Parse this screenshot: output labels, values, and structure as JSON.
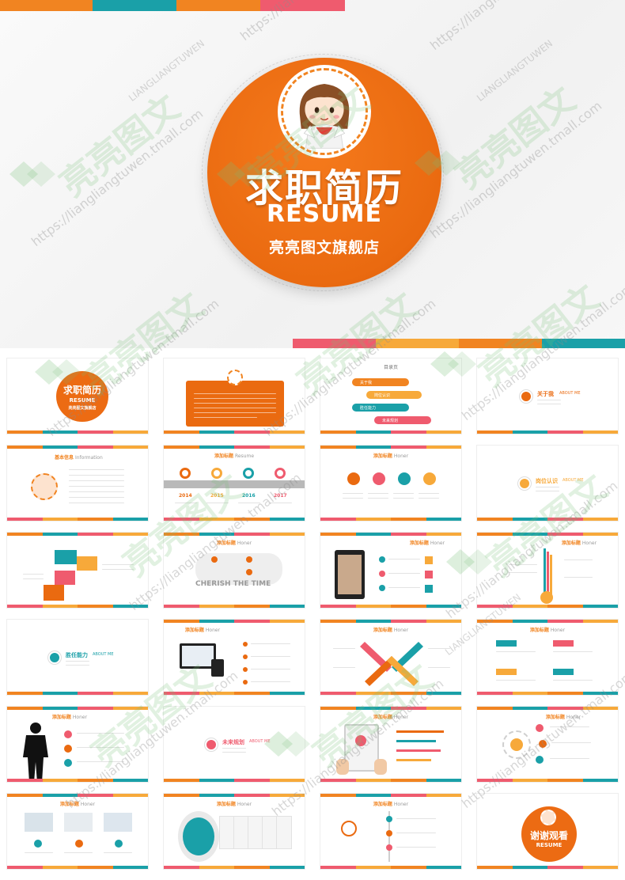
{
  "colors": {
    "orange": "#f18421",
    "teal": "#1aa0a8",
    "pink": "#ef5b6e",
    "yellow": "#f7a93a",
    "hero_circle": "#ea6a10"
  },
  "hero": {
    "title": "求职简历",
    "subtitle": "RESUME",
    "shop": "亮亮图文旗舰店"
  },
  "watermark": {
    "url": "https://liangliangtuwen.tmall.com",
    "brand": "亮亮图文",
    "pinyin": "LIANGLIANGTUWEN"
  },
  "thumbnails": {
    "cover": {
      "title": "求职简历",
      "subtitle": "RESUME",
      "shop": "亮亮图文旗舰店"
    },
    "toc": {
      "header": "目录页",
      "items": [
        {
          "label": "关于我",
          "en": "ABOUT ME"
        },
        {
          "label": "岗位认识",
          "en": ""
        },
        {
          "label": "胜任能力",
          "en": "MY ABILITY"
        },
        {
          "label": "未来规划",
          "en": ""
        }
      ]
    },
    "about_me": {
      "label": "关于我",
      "en": "ABOUT ME"
    },
    "basic_info": {
      "label": "基本信息",
      "en": "Information"
    },
    "timeline": {
      "header": "添加标题",
      "header_en": "Resume",
      "years": [
        "2014",
        "2015",
        "2016",
        "2017"
      ]
    },
    "honor_header": {
      "label": "添加标题",
      "en": "Honer"
    },
    "job_recognition": {
      "label": "岗位认识",
      "en": "ABOUT ME"
    },
    "cherish": {
      "text": "CHERISH THE TIME"
    },
    "ability": {
      "label": "胜任能力",
      "en": "ABOUT ME"
    },
    "future": {
      "label": "未来规划",
      "en": "ABOUT ME"
    },
    "thanks": {
      "title": "谢谢观看",
      "subtitle": "RESUME"
    }
  }
}
